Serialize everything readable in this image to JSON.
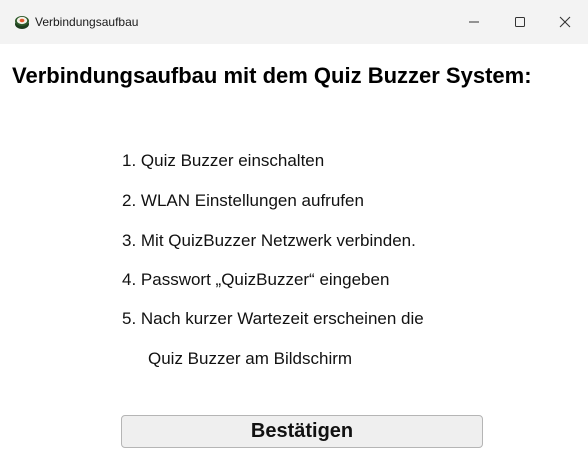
{
  "window": {
    "title": "Verbindungsaufbau",
    "app_icon": "sushi-roll-icon",
    "controls": [
      "minimize-icon",
      "maximize-icon",
      "close-icon"
    ]
  },
  "main": {
    "heading": "Verbindungsaufbau mit dem Quiz Buzzer System:",
    "steps": [
      "1. Quiz Buzzer einschalten",
      "2. WLAN Einstellungen aufrufen",
      "3. Mit QuizBuzzer Netzwerk verbinden.",
      "4. Passwort „QuizBuzzer“ eingeben",
      "5. Nach kurzer Wartezeit erscheinen die",
      "Quiz Buzzer am Bildschirm"
    ],
    "confirm_label": "Bestätigen"
  }
}
